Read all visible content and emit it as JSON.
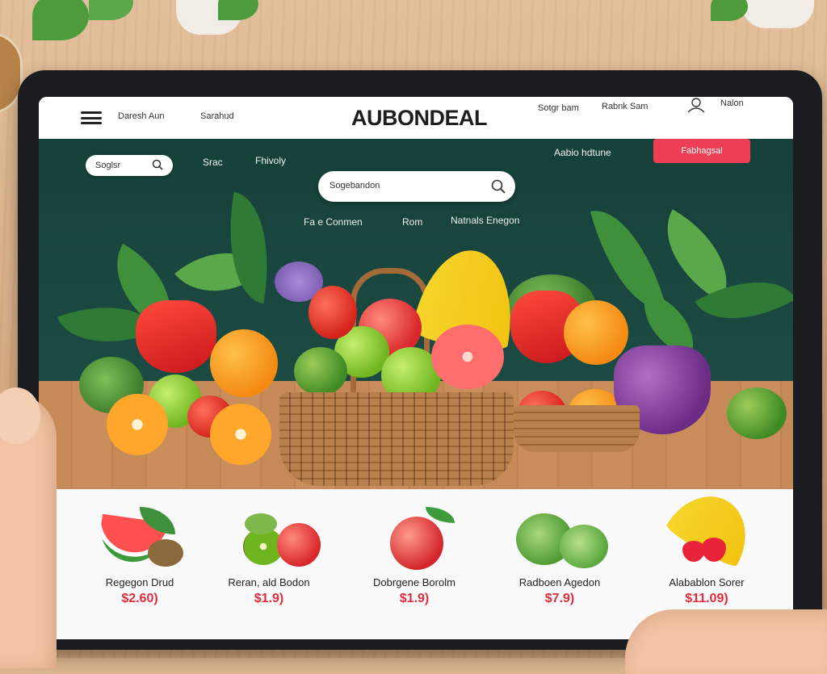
{
  "nav": {
    "link_1": "Daresh Aun",
    "link_2": "Sarahud",
    "brand": "AUBONDEAL",
    "link_3": "Sotgr bam",
    "link_4": "Rabnk Sam",
    "account": "Nalon"
  },
  "hero": {
    "small_search_placeholder": "Soglsr",
    "link_store": "Srac",
    "link_fruits": "Fhivoly",
    "main_search_placeholder": "Sogebandon",
    "cat_1": "Fa e Conmen",
    "cat_2": "Rom",
    "cat_3": "Natnals Enegon",
    "promo_text": "Aabio hdtune",
    "cta_label": "Fabhagsal"
  },
  "products": [
    {
      "name": "Regegon Drud",
      "price": "$2.60)",
      "icon": "watermelon-icon"
    },
    {
      "name": "Reran, ald Bodon",
      "price": "$1.9)",
      "icon": "kiwi-apple-icon"
    },
    {
      "name": "Dobrgene Borolm",
      "price": "$1.9)",
      "icon": "apple-icon"
    },
    {
      "name": "Radboen Agedon",
      "price": "$7.9)",
      "icon": "cabbage-icon"
    },
    {
      "name": "Alabablon Sorer",
      "price": "$11.09)",
      "icon": "banana-strawberry-icon"
    }
  ],
  "colors": {
    "hero_bg": "#1b4a42",
    "cta": "#ec3f55",
    "price": "#e32b3d"
  }
}
